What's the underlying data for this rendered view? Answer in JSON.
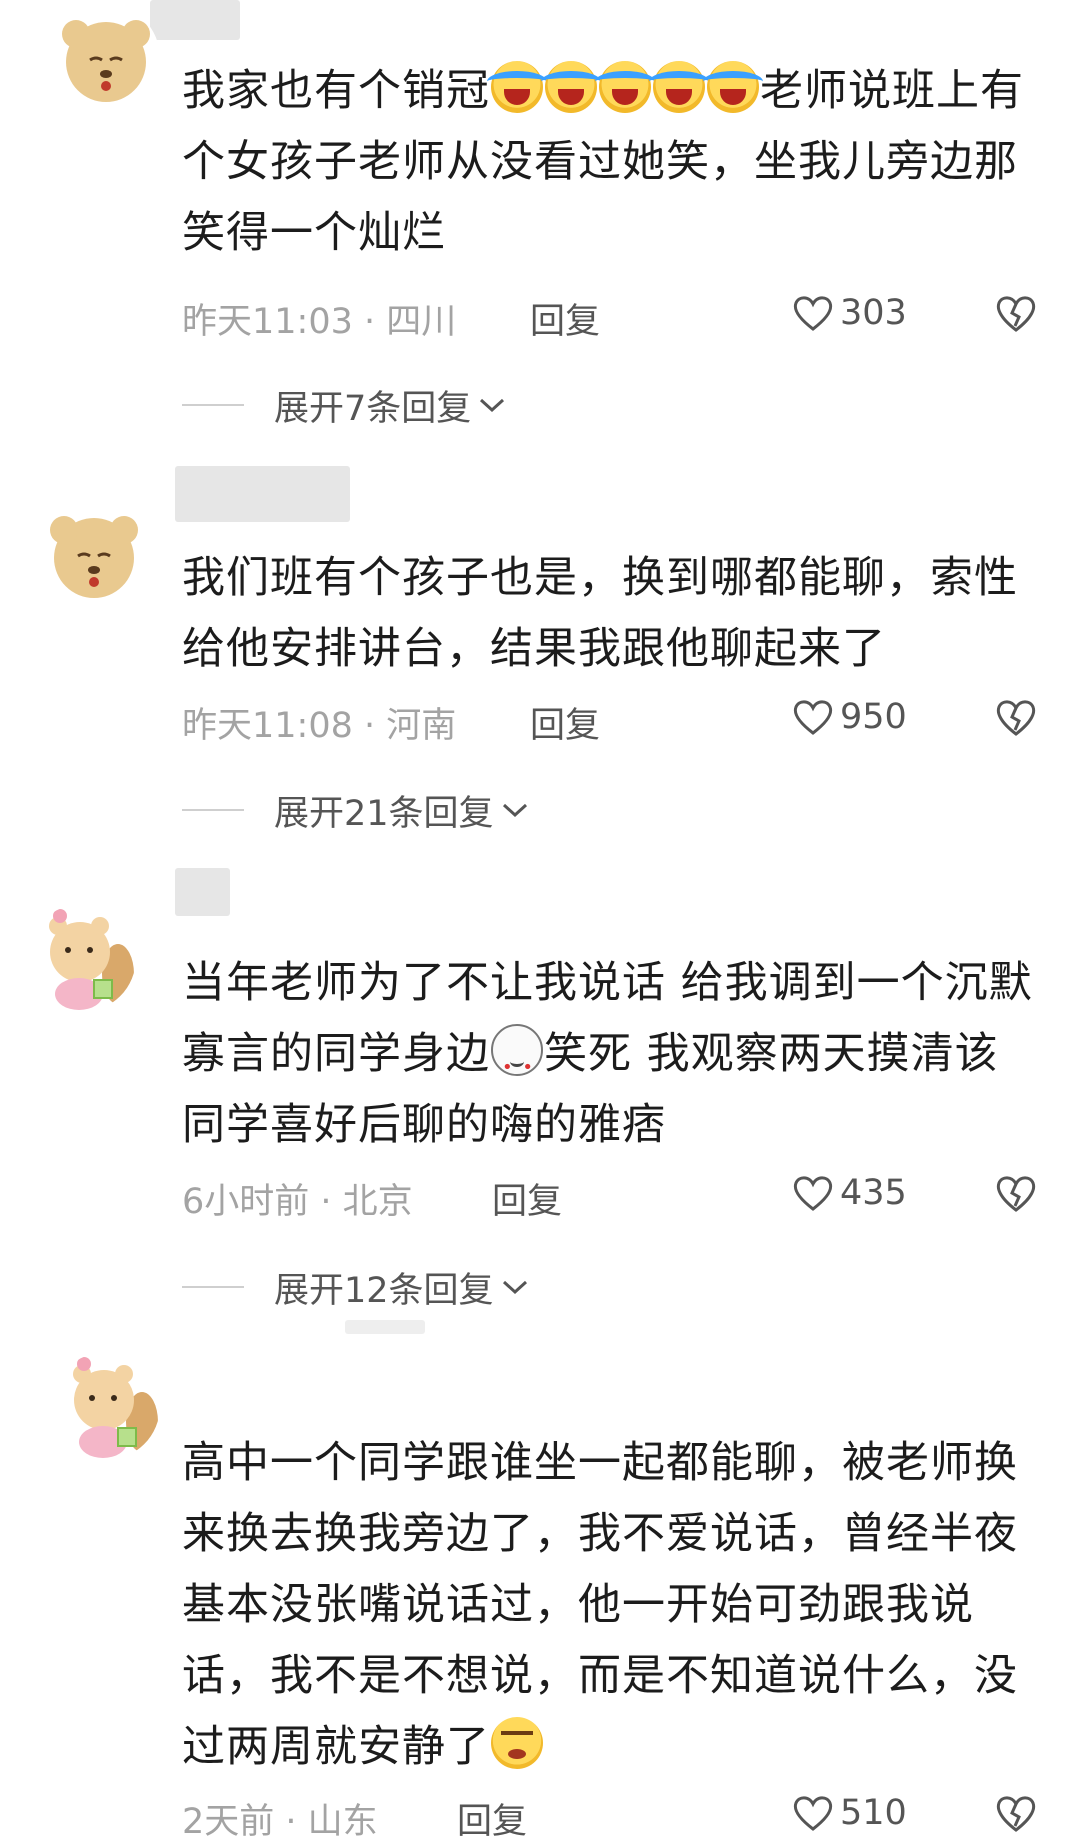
{
  "comments": [
    {
      "text_parts": [
        "我家也有个销冠",
        "老师说班上有个女孩子老师从没看过她笑，坐我儿旁边那笑得一个灿烂"
      ],
      "emoji": [
        "crying-laughing-emoji",
        "crying-laughing-emoji",
        "crying-laughing-emoji",
        "crying-laughing-emoji",
        "crying-laughing-emoji"
      ],
      "time": "昨天11:03 · 四川",
      "reply_label": "回复",
      "likes": "303",
      "expand_label": "展开7条回复"
    },
    {
      "text": "我们班有个孩子也是，换到哪都能聊，索性给他安排讲台，结果我跟他聊起来了",
      "time": "昨天11:08 · 河南",
      "reply_label": "回复",
      "likes": "950",
      "expand_label": "展开21条回复"
    },
    {
      "text_parts": [
        "当年老师为了不让我说话 给我调到一个沉默寡言的同学身边",
        "笑死 我观察两天摸清该同学喜好后聊的嗨的雅痞"
      ],
      "emoji": [
        "cat-emoji"
      ],
      "time": "6小时前 · 北京",
      "reply_label": "回复",
      "likes": "435",
      "expand_label": "展开12条回复"
    },
    {
      "text_parts": [
        "高中一个同学跟谁坐一起都能聊，被老师换来换去换我旁边了，我不爱说话，曾经半夜基本没张嘴说话过，他一开始可劲跟我说话，我不是不想说，而是不知道说什么，没过两周就安静了",
        ""
      ],
      "emoji": [
        "smirk-emoji"
      ],
      "time": "2天前 · 山东",
      "reply_label": "回复",
      "likes": "510"
    }
  ],
  "colors": {
    "text": "#1c1c1c",
    "meta": "#a3a3a3",
    "action": "#555555",
    "divider": "#cfcfcf"
  }
}
